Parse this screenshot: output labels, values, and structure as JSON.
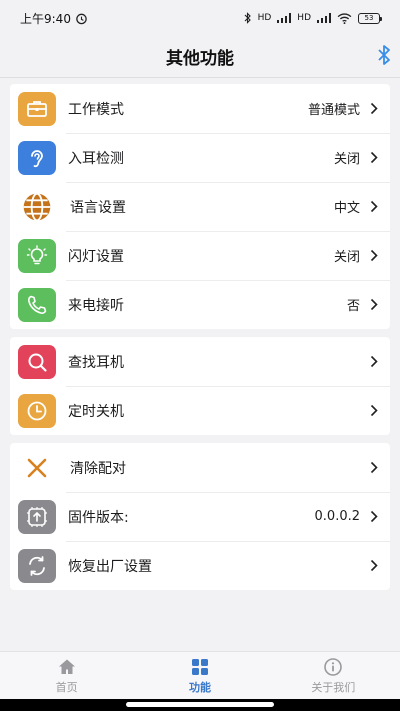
{
  "statusbar": {
    "time": "上午9:40",
    "network": "HD",
    "battery": "53"
  },
  "header": {
    "title": "其他功能"
  },
  "groups": [
    {
      "items": [
        {
          "label": "工作模式",
          "value": "普通模式",
          "icon": "briefcase-icon",
          "color": "#e9a640"
        },
        {
          "label": "入耳检测",
          "value": "关闭",
          "icon": "ear-icon",
          "color": "#3d7fdc"
        },
        {
          "label": "语言设置",
          "value": "中文",
          "icon": "globe-icon",
          "color": "#c4731a"
        },
        {
          "label": "闪灯设置",
          "value": "关闭",
          "icon": "lightbulb-icon",
          "color": "#5cbe5c"
        },
        {
          "label": "来电接听",
          "value": "否",
          "icon": "phone-icon",
          "color": "#5cbe5c"
        }
      ]
    },
    {
      "items": [
        {
          "label": "查找耳机",
          "value": "",
          "icon": "search-icon",
          "color": "#e2435a"
        },
        {
          "label": "定时关机",
          "value": "",
          "icon": "clock-icon",
          "color": "#e9a640"
        }
      ]
    },
    {
      "items": [
        {
          "label": "清除配对",
          "value": "",
          "icon": "close-icon",
          "color": "#d9801f"
        },
        {
          "label": "固件版本:",
          "value": "0.0.0.2",
          "icon": "firmware-icon",
          "color": "#8a8a8e"
        },
        {
          "label": "恢复出厂设置",
          "value": "",
          "icon": "reset-icon",
          "color": "#8a8a8e"
        }
      ]
    }
  ],
  "tabbar": {
    "tabs": [
      {
        "label": "首页",
        "icon": "home-icon"
      },
      {
        "label": "功能",
        "icon": "grid-icon",
        "active": true
      },
      {
        "label": "关于我们",
        "icon": "info-icon"
      }
    ]
  },
  "colors": {
    "accent": "#3a78c9",
    "bluetooth": "#3a8ee6"
  }
}
